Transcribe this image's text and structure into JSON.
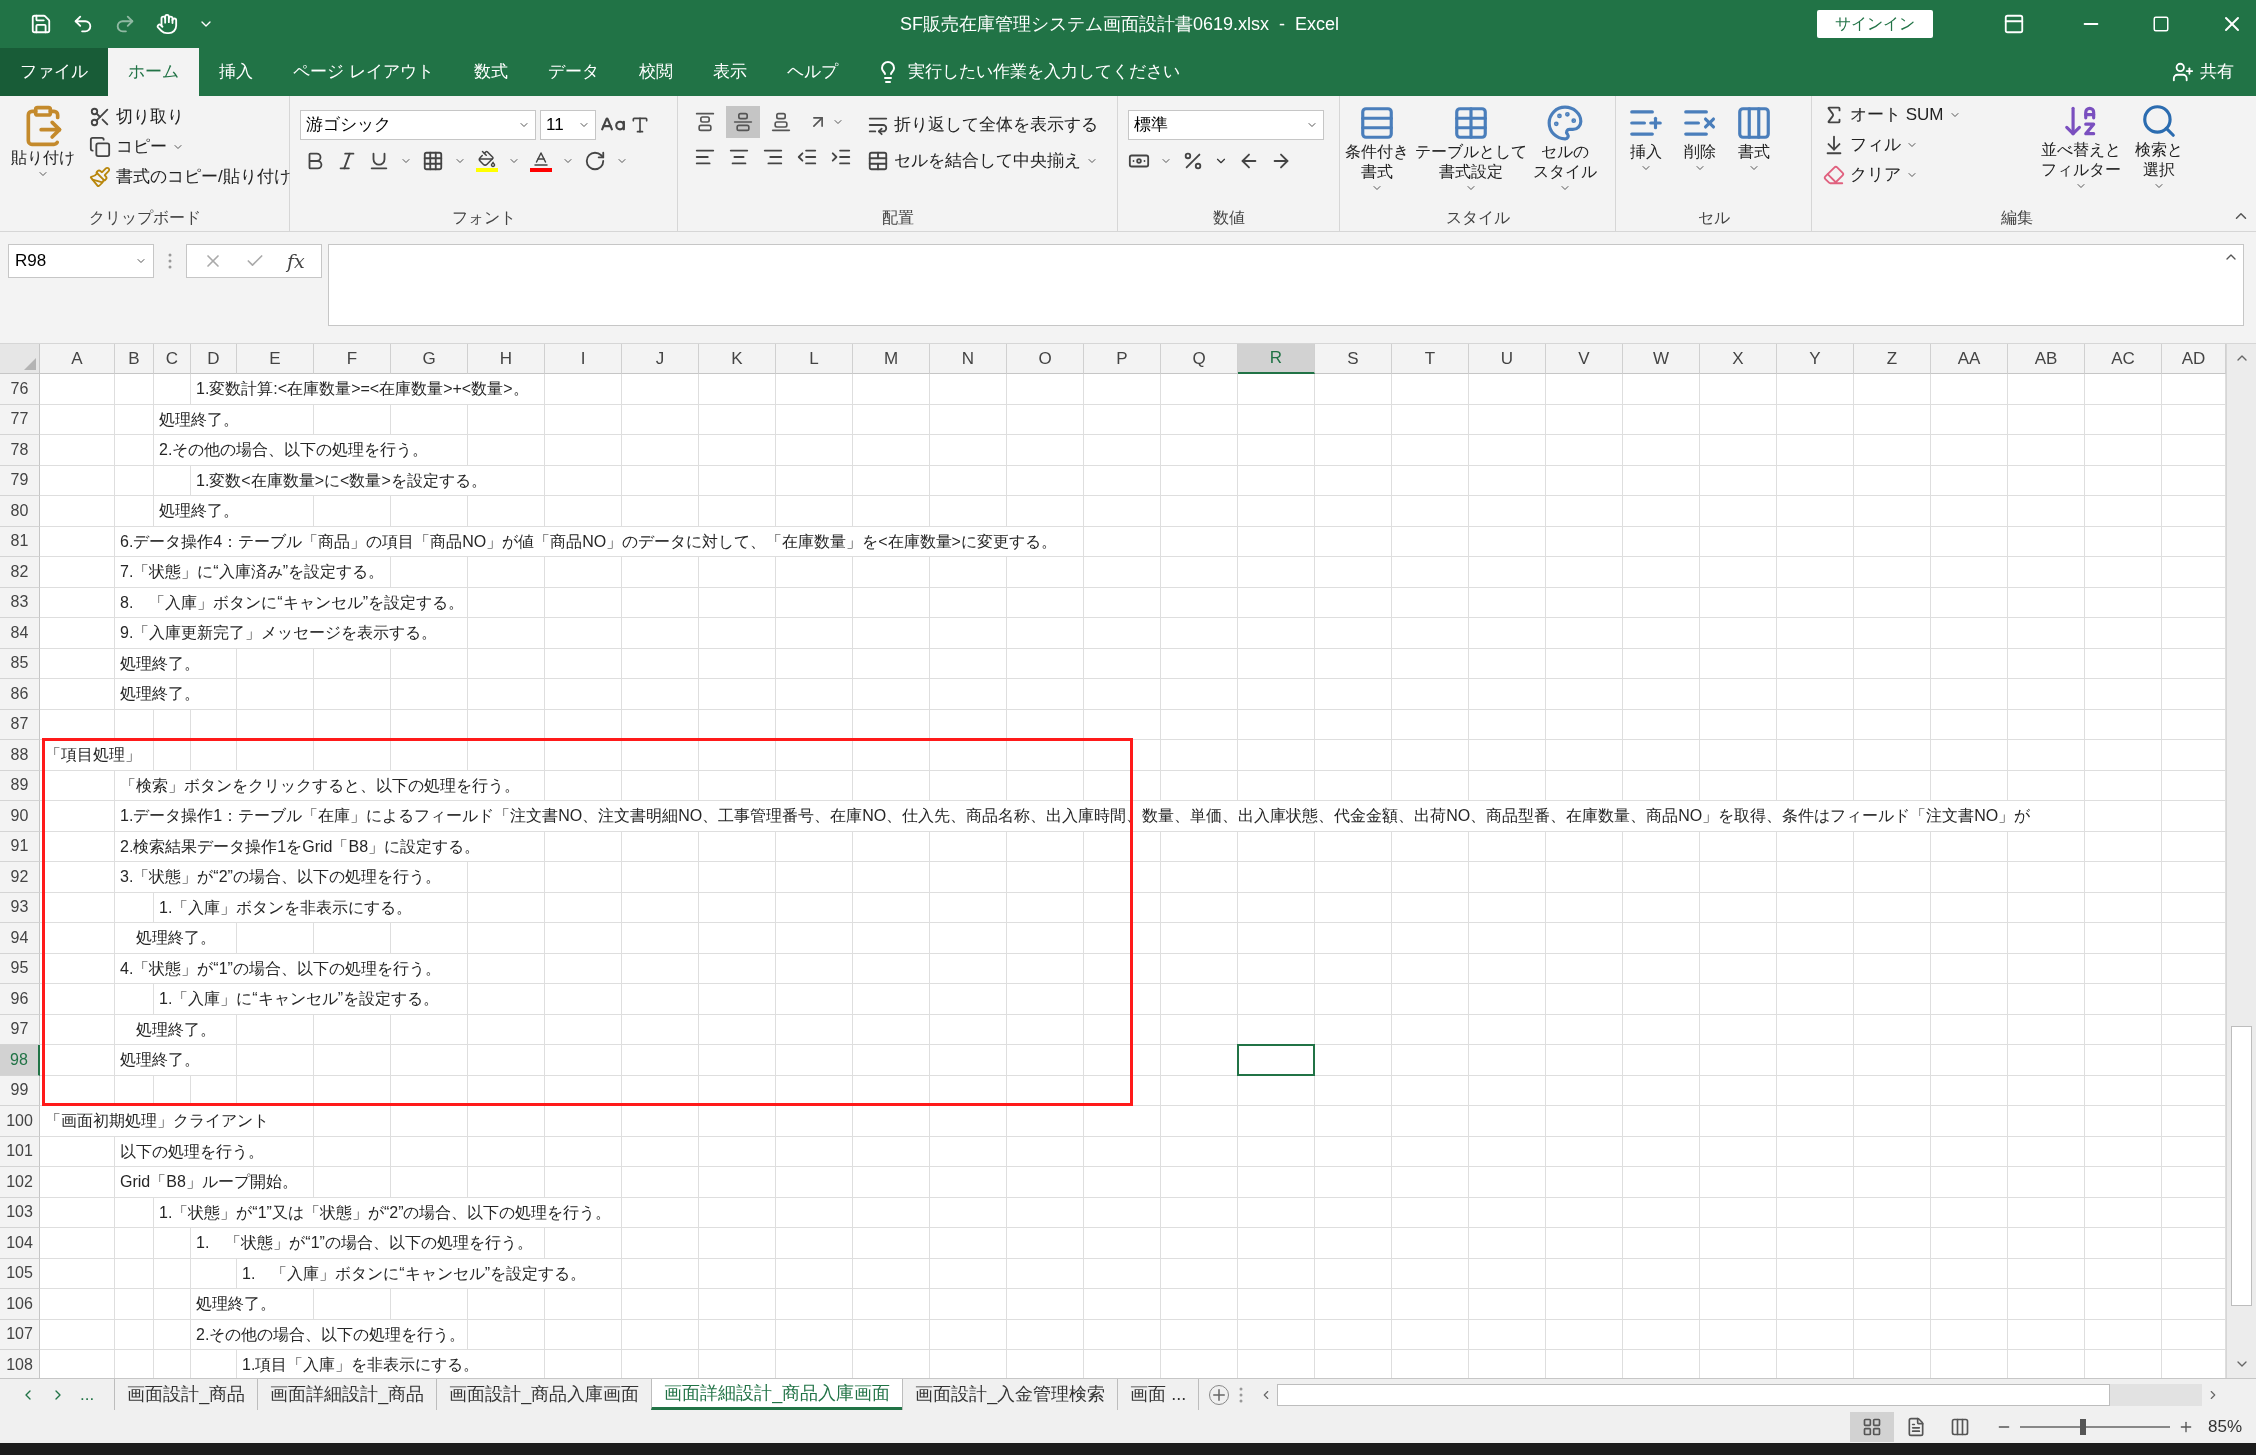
{
  "title_bar": {
    "title": "SF販売在庫管理システム画面設計書0619.xlsx  -  Excel",
    "sign_in": "サインイン"
  },
  "menu_tabs": [
    {
      "label": "ファイル",
      "kind": "file",
      "selected": false
    },
    {
      "label": "ホーム",
      "kind": "tab",
      "selected": true
    },
    {
      "label": "挿入",
      "kind": "tab",
      "selected": false
    },
    {
      "label": "ページ レイアウト",
      "kind": "tab",
      "selected": false
    },
    {
      "label": "数式",
      "kind": "tab",
      "selected": false
    },
    {
      "label": "データ",
      "kind": "tab",
      "selected": false
    },
    {
      "label": "校閲",
      "kind": "tab",
      "selected": false
    },
    {
      "label": "表示",
      "kind": "tab",
      "selected": false
    },
    {
      "label": "ヘルプ",
      "kind": "tab",
      "selected": false
    }
  ],
  "tell_me": "実行したい作業を入力してください",
  "share": "共有",
  "ribbon": {
    "clipboard": {
      "title": "クリップボード",
      "paste": "貼り付け",
      "cut": "切り取り",
      "copy": "コピー",
      "format_painter": "書式のコピー/貼り付け"
    },
    "font": {
      "title": "フォント",
      "font_name": "游ゴシック",
      "font_size": "11"
    },
    "alignment": {
      "title": "配置",
      "vertical_align": [
        {
          "selected": false
        },
        {
          "selected": true
        },
        {
          "selected": false
        }
      ],
      "wrap_text": "折り返して全体を表示する",
      "merge_center": "セルを結合して中央揃え"
    },
    "number": {
      "title": "数値",
      "format": "標準"
    },
    "styles": {
      "title": "スタイル",
      "buttons": [
        [
          "条件付き",
          "書式"
        ],
        [
          "テーブルとして",
          "書式設定"
        ],
        [
          "セルの",
          "スタイル"
        ]
      ]
    },
    "cells": {
      "title": "セル",
      "buttons": [
        "挿入",
        "削除",
        "書式"
      ]
    },
    "editing": {
      "title": "編集",
      "autosum": "オート SUM",
      "fill": "フィル",
      "clear": "クリア",
      "sort_filter": [
        "並べ替えと",
        "フィルター"
      ],
      "find_select": [
        "検索と",
        "選択"
      ]
    }
  },
  "formula_bar": {
    "name_box": "R98",
    "fx": "fx"
  },
  "columns": [
    {
      "label": "A",
      "selected": false
    },
    {
      "label": "B",
      "selected": false
    },
    {
      "label": "C",
      "selected": false
    },
    {
      "label": "D",
      "selected": false
    },
    {
      "label": "E",
      "selected": false
    },
    {
      "label": "F",
      "selected": false
    },
    {
      "label": "G",
      "selected": false
    },
    {
      "label": "H",
      "selected": false
    },
    {
      "label": "I",
      "selected": false
    },
    {
      "label": "J",
      "selected": false
    },
    {
      "label": "K",
      "selected": false
    },
    {
      "label": "L",
      "selected": false
    },
    {
      "label": "M",
      "selected": false
    },
    {
      "label": "N",
      "selected": false
    },
    {
      "label": "O",
      "selected": false
    },
    {
      "label": "P",
      "selected": false
    },
    {
      "label": "Q",
      "selected": false
    },
    {
      "label": "R",
      "selected": true
    },
    {
      "label": "S",
      "selected": false
    },
    {
      "label": "T",
      "selected": false
    },
    {
      "label": "U",
      "selected": false
    },
    {
      "label": "V",
      "selected": false
    },
    {
      "label": "W",
      "selected": false
    },
    {
      "label": "X",
      "selected": false
    },
    {
      "label": "Y",
      "selected": false
    },
    {
      "label": "Z",
      "selected": false
    },
    {
      "label": "AA",
      "selected": false
    },
    {
      "label": "AB",
      "selected": false
    },
    {
      "label": "AC",
      "selected": false
    },
    {
      "label": "AD",
      "selected": false
    }
  ],
  "rows": [
    {
      "number": "76",
      "selected": false,
      "cells": {
        "D": "1.変数計算:<在庫数量>=<在庫数量>+<数量>。"
      }
    },
    {
      "number": "77",
      "selected": false,
      "cells": {
        "C": "処理終了。"
      }
    },
    {
      "number": "78",
      "selected": false,
      "cells": {
        "C": "2.その他の場合、以下の処理を行う。"
      }
    },
    {
      "number": "79",
      "selected": false,
      "cells": {
        "D": "1.変数<在庫数量>に<数量>を設定する。"
      }
    },
    {
      "number": "80",
      "selected": false,
      "cells": {
        "C": "処理終了。"
      }
    },
    {
      "number": "81",
      "selected": false,
      "cells": {
        "B": "6.データ操作4：テーブル「商品」の項目「商品NO」が値「商品NO」のデータに対して、「在庫数量」を<在庫数量>に変更する。"
      }
    },
    {
      "number": "82",
      "selected": false,
      "cells": {
        "B": "7.「状態」に“入庫済み”を設定する。"
      }
    },
    {
      "number": "83",
      "selected": false,
      "cells": {
        "B": "8.　「入庫」ボタンに“キャンセル”を設定する。"
      }
    },
    {
      "number": "84",
      "selected": false,
      "cells": {
        "B": "9.「入庫更新完了」メッセージを表示する。"
      }
    },
    {
      "number": "85",
      "selected": false,
      "cells": {
        "B": "処理終了。"
      }
    },
    {
      "number": "86",
      "selected": false,
      "cells": {
        "B": "処理終了。"
      }
    },
    {
      "number": "87",
      "selected": false
    },
    {
      "number": "88",
      "selected": false,
      "cells": {
        "A": "「項目処理」"
      }
    },
    {
      "number": "89",
      "selected": false,
      "cells": {
        "B": "「検索」ボタンをクリックすると、以下の処理を行う。"
      }
    },
    {
      "number": "90",
      "selected": false,
      "cells": {
        "B": "1.データ操作1：テーブル「在庫」によるフィールド「注文書NO、注文書明細NO、工事管理番号、在庫NO、仕入先、商品名称、出入庫時間、数量、単価、出入庫状態、代金金額、出荷NO、商品型番、在庫数量、商品NO」を取得、条件はフィールド「注文書NO」が"
      }
    },
    {
      "number": "91",
      "selected": false,
      "cells": {
        "B": "2.検索結果データ操作1をGrid「B8」に設定する。"
      }
    },
    {
      "number": "92",
      "selected": false,
      "cells": {
        "B": "3.「状態」が“2”の場合、以下の処理を行う。"
      }
    },
    {
      "number": "93",
      "selected": false,
      "cells": {
        "C": "1.「入庫」ボタンを非表示にする。"
      }
    },
    {
      "number": "94",
      "selected": false,
      "cells": {
        "B": "　処理終了。"
      }
    },
    {
      "number": "95",
      "selected": false,
      "cells": {
        "B": "4.「状態」が“1”の場合、以下の処理を行う。"
      }
    },
    {
      "number": "96",
      "selected": false,
      "cells": {
        "C": "1.「入庫」に“キャンセル”を設定する。"
      }
    },
    {
      "number": "97",
      "selected": false,
      "cells": {
        "B": "　処理終了。"
      }
    },
    {
      "number": "98",
      "selected": true,
      "cells": {
        "B": "処理終了。"
      }
    },
    {
      "number": "99",
      "selected": false
    },
    {
      "number": "100",
      "selected": false,
      "cells": {
        "A": "「画面初期処理」クライアント"
      }
    },
    {
      "number": "101",
      "selected": false,
      "cells": {
        "B": "以下の処理を行う。"
      }
    },
    {
      "number": "102",
      "selected": false,
      "cells": {
        "B": "Grid「B8」ループ開始。"
      }
    },
    {
      "number": "103",
      "selected": false,
      "cells": {
        "C": "1.「状態」が“1”又は「状態」が“2”の場合、以下の処理を行う。"
      }
    },
    {
      "number": "104",
      "selected": false,
      "cells": {
        "D": "1.　「状態」が“1”の場合、以下の処理を行う。"
      }
    },
    {
      "number": "105",
      "selected": false,
      "cells": {
        "E": "1.　「入庫」ボタンに“キャンセル”を設定する。"
      }
    },
    {
      "number": "106",
      "selected": false,
      "cells": {
        "D": "処理終了。"
      }
    },
    {
      "number": "107",
      "selected": false,
      "cells": {
        "D": "2.その他の場合、以下の処理を行う。"
      }
    },
    {
      "number": "108",
      "selected": false,
      "cells": {
        "E": "1.項目「入庫」を非表示にする。"
      }
    }
  ],
  "sheet_tabs": {
    "more": "...",
    "tabs": [
      {
        "label": "画面設計_商品",
        "selected": false
      },
      {
        "label": "画面詳細設計_商品",
        "selected": false
      },
      {
        "label": "画面設計_商品入庫画面",
        "selected": false
      },
      {
        "label": "画面詳細設計_商品入庫画面",
        "selected": true
      },
      {
        "label": "画面設計_入金管理検索",
        "selected": false
      },
      {
        "label": "画面 ...",
        "selected": false
      }
    ]
  },
  "status_bar": {
    "views": [
      {
        "selected": true
      },
      {
        "selected": false
      },
      {
        "selected": false
      }
    ],
    "zoom_slider": {
      "level": 0.42
    },
    "zoom": "85%"
  }
}
